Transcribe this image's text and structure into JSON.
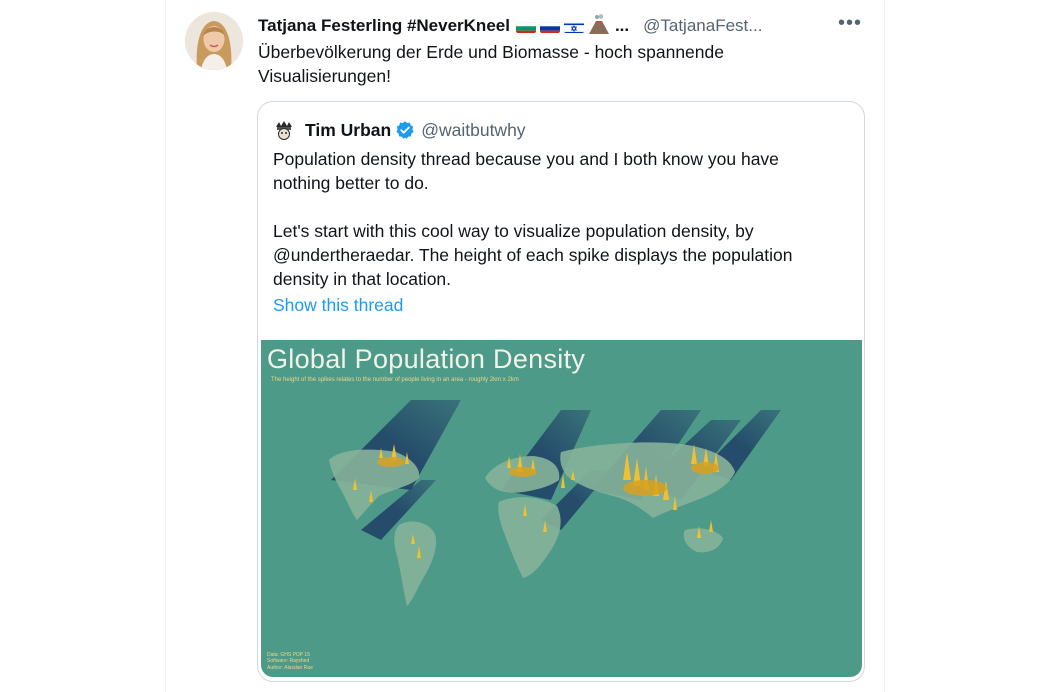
{
  "tweet": {
    "author_name": "Tatjana Festerling #NeverKneel",
    "name_truncation": "...",
    "handle": "@TatjanaFest...",
    "more_label": "•••",
    "text_line1": "Überbevölkerung der Erde und Biomasse - hoch spannende",
    "text_line2": "Visualisierungen!"
  },
  "quote": {
    "author_name": "Tim Urban",
    "handle": "@waitbutwhy",
    "paragraph1_line1": "Population density thread because you and I both know you have",
    "paragraph1_line2": "nothing better to do.",
    "paragraph2_line1": "Let's start with this cool way to visualize population density, by",
    "paragraph2_line2": "@undertheraedar. The height of each spike displays the population",
    "paragraph2_line3": "density in that location.",
    "show_thread": "Show this thread"
  },
  "media": {
    "title": "Global Population Density",
    "subtitle": "The height of the spikes relates to the number of people living in an area - roughly 2km x 2km",
    "credit_data": "Data: GHS POP 15",
    "credit_software": "Software: Rayshed",
    "credit_author": "Author: Alasdair Rae"
  },
  "colors": {
    "accent": "#1d9bf0",
    "map_background": "#4e9a88",
    "spike_yellow": "#f0c030",
    "spike_shadow": "#1e3f66"
  }
}
